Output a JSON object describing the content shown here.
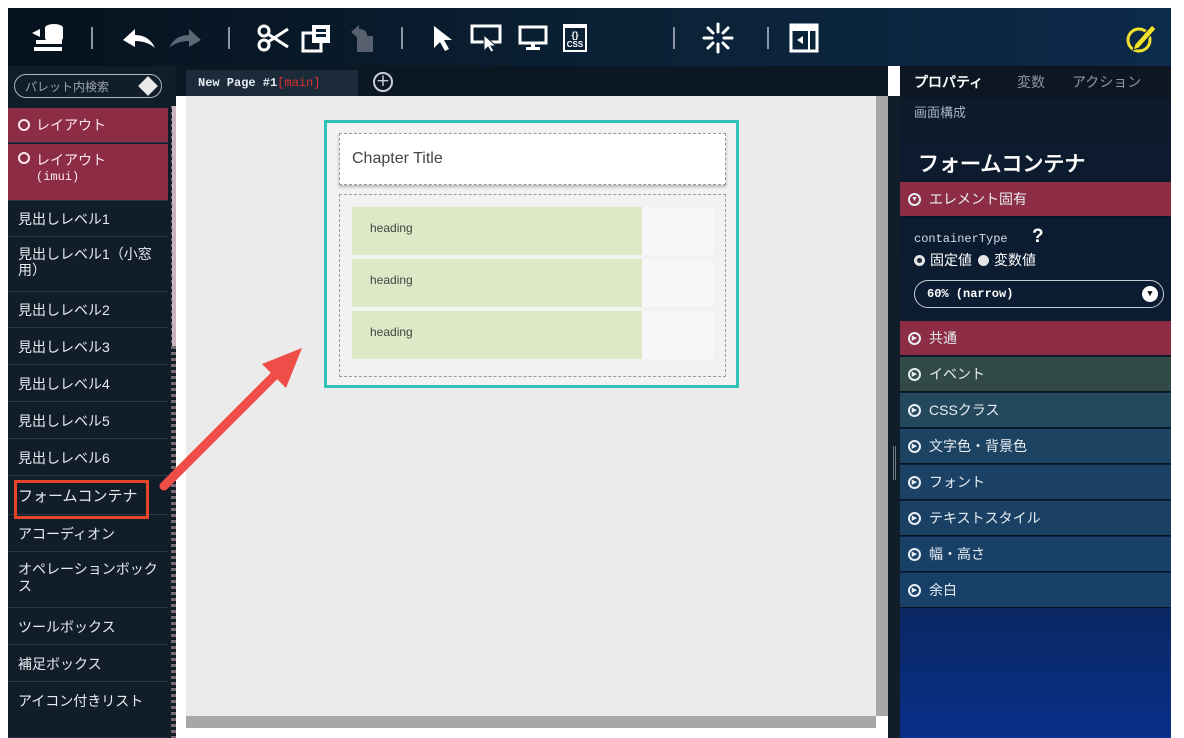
{
  "toolbar": {
    "icons": [
      "stack-icon",
      "undo-icon",
      "redo-icon",
      "scissors-icon",
      "copy-icon",
      "paste-icon",
      "pointer-icon",
      "select-icon",
      "preview-icon",
      "css-icon",
      "loading-icon",
      "panel-icon",
      "edit-icon"
    ],
    "css_label": "CSS",
    "css_braces": "{}"
  },
  "palette": {
    "search_placeholder": "パレット内検索",
    "items": [
      {
        "label": "レイアウト",
        "type": "category"
      },
      {
        "label": "レイアウト",
        "sub": "(imui)",
        "type": "category"
      },
      {
        "label": "見出しレベル1"
      },
      {
        "label": "見出しレベル1（小窓用）"
      },
      {
        "label": "見出しレベル2"
      },
      {
        "label": "見出しレベル3"
      },
      {
        "label": "見出しレベル4"
      },
      {
        "label": "見出しレベル5"
      },
      {
        "label": "見出しレベル6"
      },
      {
        "label": "フォームコンテナ"
      },
      {
        "label": "アコーディオン"
      },
      {
        "label": "オペレーションボックス"
      },
      {
        "label": "ツールボックス"
      },
      {
        "label": "補足ボックス"
      },
      {
        "label": "アイコン付きリスト"
      }
    ]
  },
  "tabs": {
    "page_name": "New Page #1",
    "page_branch": "[main]"
  },
  "canvas": {
    "chapter_title": "Chapter Title",
    "headings": [
      "heading",
      "heading",
      "heading"
    ]
  },
  "props": {
    "tabs": [
      "プロパティ",
      "変数",
      "アクション"
    ],
    "subtitle": "画面構成",
    "title": "フォームコンテナ",
    "element_section": "エレメント固有",
    "container_type_label": "containerType",
    "help_glyph": "?",
    "radio_fixed": "固定値",
    "radio_variable": "変数値",
    "container_type_value": "60% (narrow)",
    "sections": [
      "共通",
      "イベント",
      "CSSクラス",
      "文字色・背景色",
      "フォント",
      "テキストスタイル",
      "幅・高さ",
      "余白"
    ]
  },
  "colors": {
    "accent_teal": "#2ec3b6",
    "category_red": "#8c2d45",
    "highlight_red": "#e5452b",
    "arrow_red": "#ef4d48",
    "edit_yellow": "#f3e12a"
  }
}
